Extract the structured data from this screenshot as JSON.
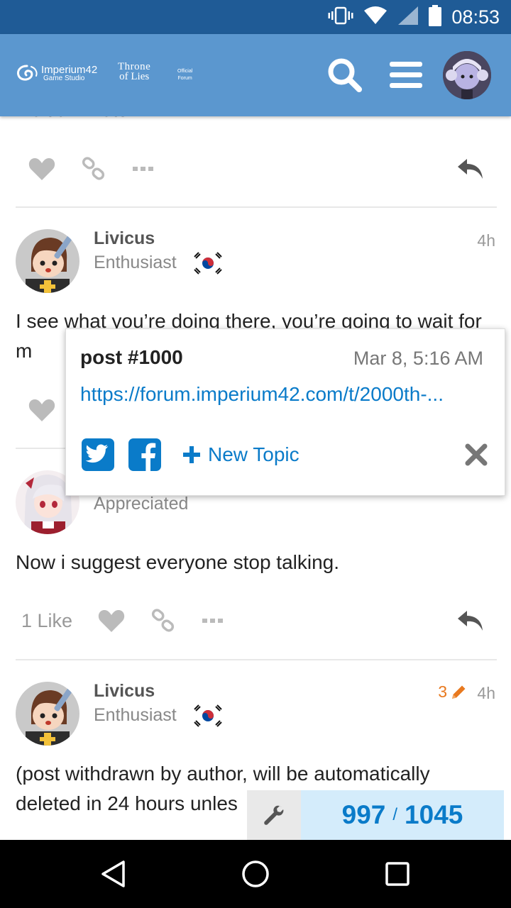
{
  "status_bar": {
    "time": "08:53"
  },
  "header": {
    "logo_imperium": "Imperium42",
    "logo_imperium_sub": "Game Studio",
    "logo_throne_line1": "Throne",
    "logo_throne_line2": "of Lies",
    "logo_official_line1": "Official",
    "logo_official_line2": "Forum"
  },
  "prev_post": {
    "cut_text": "Wait a minute..."
  },
  "posts": [
    {
      "username": "Livicus",
      "title": "Enthusiast",
      "age": "4h",
      "body": "I see what you’re doing there, you’re going to wait for m"
    },
    {
      "title": "Appreciated",
      "body": "Now i suggest everyone stop talking.",
      "likes": "1 Like"
    },
    {
      "username": "Livicus",
      "title": "Enthusiast",
      "edits": "3",
      "age": "4h",
      "body": "(post withdrawn by author, will be automatically deleted in 24 hours unles"
    }
  ],
  "share_popup": {
    "title": "post #1000",
    "date": "Mar 8, 5:16 AM",
    "link": "https://forum.imperium42.com/t/2000th-...",
    "new_topic": "New Topic"
  },
  "progress": {
    "current": "997",
    "separator": "/",
    "total": "1045"
  },
  "colors": {
    "header": "#5b97cf",
    "status_bar": "#1f5b96",
    "accent": "#0a7bc9",
    "edit": "#e8791f"
  }
}
